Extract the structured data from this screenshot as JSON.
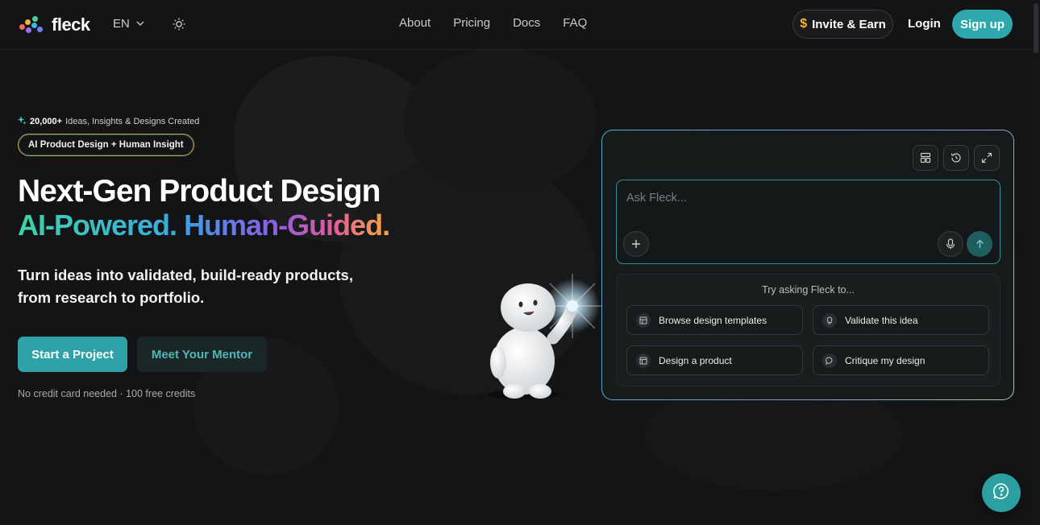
{
  "header": {
    "logo_text": "fleck",
    "language": "EN",
    "nav": [
      "About",
      "Pricing",
      "Docs",
      "FAQ"
    ],
    "invite_label": "Invite & Earn",
    "invite_symbol": "$",
    "login_label": "Login",
    "signup_label": "Sign up"
  },
  "hero": {
    "stat_count": "20,000+",
    "stat_text": "Ideas, Insights & Designs Created",
    "badge": "AI Product Design + Human Insight",
    "headline": "Next-Gen Product Design",
    "tagline_part1": "AI-Powered.",
    "tagline_part2": "Human-Guided",
    "tagline_dot": ".",
    "subheading_line1": "Turn ideas into validated, build-ready products,",
    "subheading_line2": "from research to portfolio.",
    "primary_cta": "Start a Project",
    "secondary_cta": "Meet Your Mentor",
    "fine_print": "No credit card needed · 100 free credits"
  },
  "chat": {
    "placeholder": "Ask Fleck...",
    "suggestions_title": "Try asking Fleck to...",
    "suggestions": [
      {
        "label": "Browse design templates",
        "icon": "template-icon"
      },
      {
        "label": "Validate this idea",
        "icon": "lightbulb-icon"
      },
      {
        "label": "Design a product",
        "icon": "layout-icon"
      },
      {
        "label": "Critique my design",
        "icon": "chat-bubble-icon"
      }
    ]
  },
  "colors": {
    "accent": "#2fa8ad",
    "background": "#131416",
    "invite_symbol": "#f2b431"
  }
}
